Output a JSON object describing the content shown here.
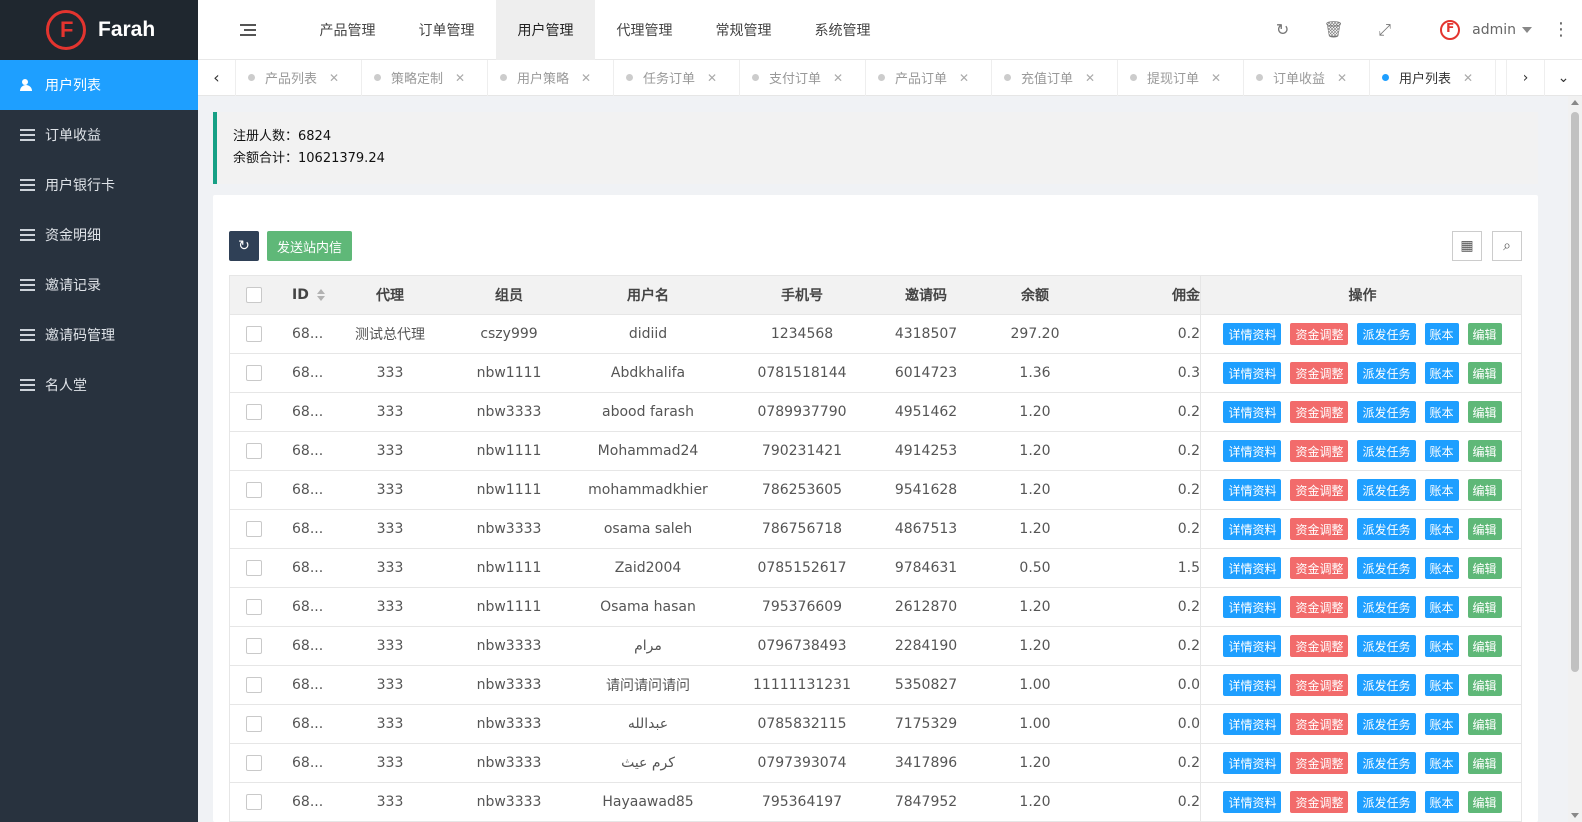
{
  "brand": {
    "name": "Farah"
  },
  "sidebar": {
    "items": [
      {
        "label": "用户列表",
        "icon": "users-icon",
        "active": true
      },
      {
        "label": "订单收益",
        "icon": "list-icon"
      },
      {
        "label": "用户银行卡",
        "icon": "list-icon"
      },
      {
        "label": "资金明细",
        "icon": "list-icon"
      },
      {
        "label": "邀请记录",
        "icon": "list-icon"
      },
      {
        "label": "邀请码管理",
        "icon": "list-icon"
      },
      {
        "label": "名人堂",
        "icon": "list-icon"
      }
    ]
  },
  "header": {
    "menu": [
      "产品管理",
      "订单管理",
      "用户管理",
      "代理管理",
      "常规管理",
      "系统管理"
    ],
    "active_menu": "用户管理",
    "icons": [
      "refresh-icon",
      "trash-icon",
      "fullscreen-icon"
    ],
    "user": "admin"
  },
  "tabs": [
    {
      "label": "产品列表"
    },
    {
      "label": "策略定制"
    },
    {
      "label": "用户策略"
    },
    {
      "label": "任务订单"
    },
    {
      "label": "支付订单"
    },
    {
      "label": "产品订单"
    },
    {
      "label": "充值订单"
    },
    {
      "label": "提现订单"
    },
    {
      "label": "订单收益"
    },
    {
      "label": "用户列表",
      "active": true
    }
  ],
  "stats": {
    "registered_label": "注册人数：",
    "registered_value": "6824",
    "balance_label": "余额合计：",
    "balance_value": "10621379.24"
  },
  "toolbar": {
    "send_label": "发送站内信"
  },
  "table": {
    "headers": {
      "id": "ID",
      "agent": "代理",
      "member": "组员",
      "username": "用户名",
      "phone": "手机号",
      "invite": "邀请码",
      "balance": "余额",
      "commission": "佣金",
      "ops": "操作"
    },
    "ops": {
      "detail": "详情资料",
      "adjust": "资金调整",
      "assign": "派发任务",
      "ledger": "账本",
      "edit": "编辑"
    },
    "rows": [
      {
        "id": "68...",
        "agent": "测试总代理",
        "member": "cszy999",
        "username": "didiid",
        "phone": "1234568",
        "invite": "4318507",
        "balance": "297.20",
        "commission": "0.2"
      },
      {
        "id": "68...",
        "agent": "333",
        "member": "nbw1111",
        "username": "Abdkhalifa",
        "phone": "0781518144",
        "invite": "6014723",
        "balance": "1.36",
        "commission": "0.3"
      },
      {
        "id": "68...",
        "agent": "333",
        "member": "nbw3333",
        "username": "abood farash",
        "phone": "0789937790",
        "invite": "4951462",
        "balance": "1.20",
        "commission": "0.2"
      },
      {
        "id": "68...",
        "agent": "333",
        "member": "nbw1111",
        "username": "Mohammad24",
        "phone": "790231421",
        "invite": "4914253",
        "balance": "1.20",
        "commission": "0.2"
      },
      {
        "id": "68...",
        "agent": "333",
        "member": "nbw1111",
        "username": "mohammadkhier",
        "phone": "786253605",
        "invite": "9541628",
        "balance": "1.20",
        "commission": "0.2"
      },
      {
        "id": "68...",
        "agent": "333",
        "member": "nbw3333",
        "username": "osama saleh",
        "phone": "786756718",
        "invite": "4867513",
        "balance": "1.20",
        "commission": "0.2"
      },
      {
        "id": "68...",
        "agent": "333",
        "member": "nbw1111",
        "username": "Zaid2004",
        "phone": "0785152617",
        "invite": "9784631",
        "balance": "0.50",
        "commission": "1.5"
      },
      {
        "id": "68...",
        "agent": "333",
        "member": "nbw1111",
        "username": "Osama hasan",
        "phone": "795376609",
        "invite": "2612870",
        "balance": "1.20",
        "commission": "0.2"
      },
      {
        "id": "68...",
        "agent": "333",
        "member": "nbw3333",
        "username": "مرام",
        "phone": "0796738493",
        "invite": "2284190",
        "balance": "1.20",
        "commission": "0.2"
      },
      {
        "id": "68...",
        "agent": "333",
        "member": "nbw3333",
        "username": "请问请问请问",
        "phone": "11111131231",
        "invite": "5350827",
        "balance": "1.00",
        "commission": "0.0"
      },
      {
        "id": "68...",
        "agent": "333",
        "member": "nbw3333",
        "username": "عبدالله",
        "phone": "0785832115",
        "invite": "7175329",
        "balance": "1.00",
        "commission": "0.0"
      },
      {
        "id": "68...",
        "agent": "333",
        "member": "nbw3333",
        "username": "كرم عيث",
        "phone": "0797393074",
        "invite": "3417896",
        "balance": "1.20",
        "commission": "0.2"
      },
      {
        "id": "68...",
        "agent": "333",
        "member": "nbw3333",
        "username": "Hayaawad85",
        "phone": "795364197",
        "invite": "7847952",
        "balance": "1.20",
        "commission": "0.2"
      }
    ]
  },
  "colors": {
    "sidebar_bg": "#28323e",
    "active_blue": "#1e9fff",
    "danger": "#f26b6b",
    "success": "#5fb878"
  }
}
